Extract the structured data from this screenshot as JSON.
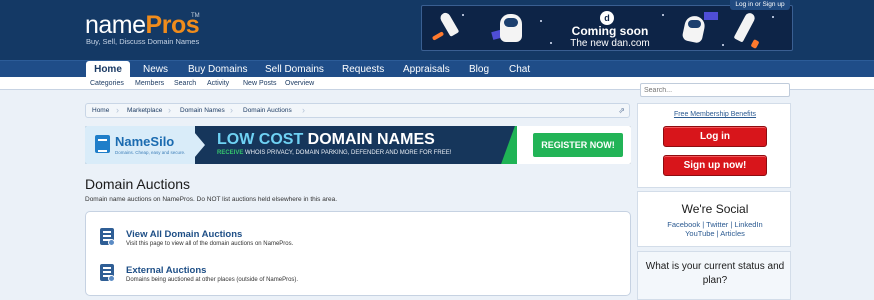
{
  "header": {
    "logo_name": "name",
    "logo_accent": "Pros",
    "logo_tm": "TM",
    "tagline": "Buy, Sell, Discuss Domain Names",
    "login_label": "Log in or Sign up",
    "banner": {
      "brand_icon": "d",
      "line1": "Coming soon",
      "line2": "The new dan.com"
    }
  },
  "nav": {
    "tabs": [
      {
        "label": "Home",
        "active": true
      },
      {
        "label": "News"
      },
      {
        "label": "Buy Domains"
      },
      {
        "label": "Sell Domains"
      },
      {
        "label": "Requests"
      },
      {
        "label": "Appraisals"
      },
      {
        "label": "Blog"
      },
      {
        "label": "Chat"
      }
    ],
    "sub": [
      "Categories",
      "Members",
      "Search",
      "Activity",
      "New Posts",
      "Overview"
    ]
  },
  "breadcrumb": [
    "Home",
    "Marketplace",
    "Domain Names",
    "Domain Auctions"
  ],
  "ad": {
    "brand": "NameSilo",
    "brand_sub": "Domains. Cheap, easy and secure.",
    "headline_accent": "LOW COST",
    "headline_main": "DOMAIN NAMES",
    "sub_accent": "RECEIVE",
    "sub_main": "WHOIS PRIVACY, DOMAIN PARKING, DEFENDER AND MORE FOR FREE!",
    "cta": "REGISTER NOW!"
  },
  "page": {
    "title": "Domain Auctions",
    "description": "Domain name auctions on NamePros. Do NOT list auctions held elsewhere in this area."
  },
  "forums": [
    {
      "name": "View All Domain Auctions",
      "description": "Visit this page to view all of the domain auctions on NamePros."
    },
    {
      "name": "External Auctions",
      "description": "Domains being auctioned at other places (outside of NamePros)."
    }
  ],
  "sidebar": {
    "search_placeholder": "Search...",
    "free_membership": "Free Membership Benefits",
    "login_button": "Log in",
    "signup_button": "Sign up now!",
    "social_heading": "We're Social",
    "social_line1": "Facebook | Twitter | LinkedIn",
    "social_line2": "YouTube | Articles",
    "status_question": "What is your current status and plan?"
  },
  "colors": {
    "header_bg": "#143965",
    "nav_bg": "#1f4d88",
    "logo_accent": "#f08c1c",
    "cta_green": "#22b457",
    "button_red": "#d8151b"
  }
}
